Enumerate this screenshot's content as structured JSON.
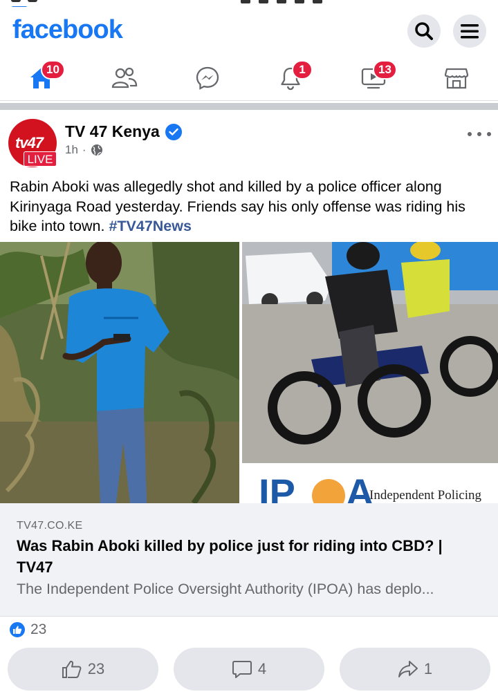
{
  "app": {
    "logo_text": "facebook",
    "brand_color": "#1877f2"
  },
  "nav": {
    "items": [
      {
        "name": "home",
        "badge": "10"
      },
      {
        "name": "friends",
        "badge": ""
      },
      {
        "name": "messenger",
        "badge": ""
      },
      {
        "name": "notifications",
        "badge": "1"
      },
      {
        "name": "watch",
        "badge": "13"
      },
      {
        "name": "marketplace",
        "badge": ""
      }
    ]
  },
  "post": {
    "author": "TV 47 Kenya",
    "avatar_text": "tv47",
    "live_label": "LIVE",
    "time": "1h",
    "text": "Rabin Aboki was allegedly shot and killed by a police officer along Kirinyaga Road yesterday. Friends say his only offense was riding his bike into town.",
    "hashtag": "#TV47News",
    "image_right_caption": "Independent Policing",
    "image_right_logo": "IPOA"
  },
  "link_preview": {
    "domain": "TV47.CO.KE",
    "title": "Was Rabin Aboki killed by police just for riding into CBD? | TV47",
    "description": "The Independent Police Oversight Authority (IPOA) has deplo..."
  },
  "reactions": {
    "count": "23"
  },
  "actions": {
    "like_count": "23",
    "comment_count": "4",
    "share_count": "1"
  },
  "icons": [
    "search-icon",
    "menu-icon",
    "home-icon",
    "friends-icon",
    "messenger-icon",
    "bell-icon",
    "watch-icon",
    "marketplace-icon",
    "verified-icon",
    "globe-icon",
    "more-icon",
    "like-icon",
    "comment-icon",
    "share-icon"
  ]
}
